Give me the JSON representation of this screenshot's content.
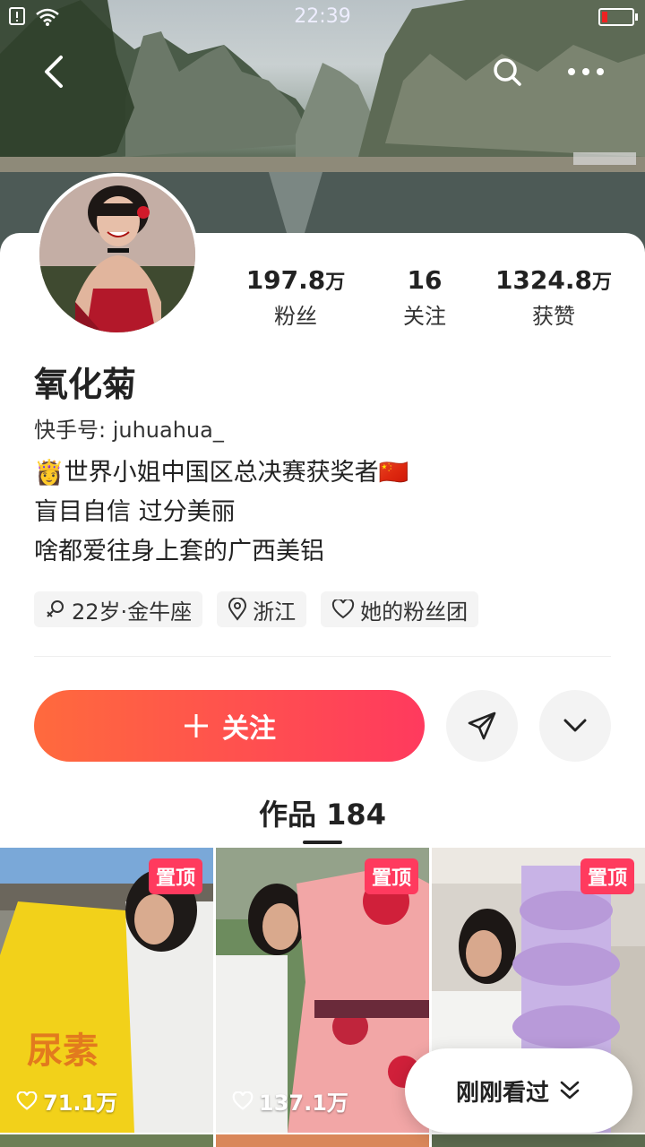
{
  "status_bar": {
    "time": "22:39"
  },
  "profile": {
    "name": "氧化菊",
    "kuaishou_id": "快手号: juhuahua_",
    "bio": [
      "世界小姐中国区总决赛获奖者",
      "盲目自信 过分美丽",
      "啥都爱往身上套的广西美铝"
    ],
    "bio_emoji_prefix": "👸",
    "bio_emoji_suffix": "🇨🇳",
    "tags": [
      {
        "icon": "gender-female-icon",
        "label": "22岁·金牛座"
      },
      {
        "icon": "location-pin-icon",
        "label": "浙江"
      },
      {
        "icon": "heart-icon",
        "label": "她的粉丝团"
      }
    ]
  },
  "stats": [
    {
      "num": "197.8",
      "unit": "万",
      "label": "粉丝"
    },
    {
      "num": "16",
      "unit": "",
      "label": "关注"
    },
    {
      "num": "1324.8",
      "unit": "万",
      "label": "获赞"
    }
  ],
  "actions": {
    "follow_label": "关注",
    "follow_icon": "plus-icon"
  },
  "works_tab": {
    "label": "作品 184"
  },
  "works": [
    {
      "pinned_label": "置顶",
      "likes": "71.1万"
    },
    {
      "pinned_label": "置顶",
      "likes": "137.1万"
    },
    {
      "pinned_label": "置顶",
      "likes": ""
    }
  ],
  "recent_button": {
    "label": "刚刚看过"
  },
  "colors": {
    "accent_start": "#ff6a3d",
    "accent_end": "#ff3a5e",
    "pin_badge": "#ff3a5e"
  }
}
